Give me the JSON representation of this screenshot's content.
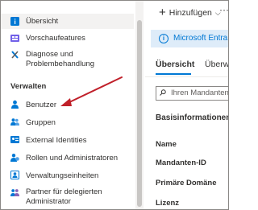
{
  "nav": {
    "collapse_icon": "double-chevron-left",
    "items_top": [
      {
        "label": "Übersicht",
        "icon": "info-icon",
        "selected": true
      },
      {
        "label": "Vorschaufeatures",
        "icon": "preview-features-icon"
      },
      {
        "label": "Diagnose und\nProblembehandlung",
        "icon": "wrench-icon"
      }
    ],
    "section_title": "Verwalten",
    "items_manage": [
      {
        "label": "Benutzer",
        "icon": "user-icon"
      },
      {
        "label": "Gruppen",
        "icon": "group-icon"
      },
      {
        "label": "External Identities",
        "icon": "external-identities-icon"
      },
      {
        "label": "Rollen und Administratoren",
        "icon": "roles-icon"
      },
      {
        "label": "Verwaltungseinheiten",
        "icon": "admin-units-icon"
      },
      {
        "label": "Partner für delegierten\nAdministrator",
        "icon": "partner-icon"
      }
    ]
  },
  "main": {
    "add_button": "Hinzufügen",
    "more_label": "···",
    "info_link": "Microsoft Entra v",
    "tabs": [
      "Übersicht",
      "Überwa"
    ],
    "search_placeholder": "Ihren Mandanten",
    "section_heading": "Basisinformationen",
    "properties": [
      "Name",
      "Mandanten-ID",
      "Primäre Domäne",
      "Lizenz"
    ]
  },
  "colors": {
    "accent": "#0078d4",
    "annotation_arrow": "#c0202a",
    "selected_bg": "#f3f2f1"
  }
}
